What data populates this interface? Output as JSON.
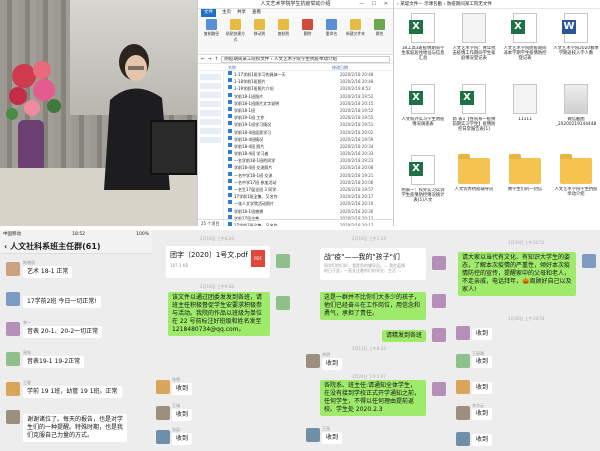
{
  "explorer": {
    "window_title": "人文艺术学院学生抗疫举动介绍",
    "ribbon_tabs": [
      "文件",
      "主页",
      "共享",
      "查看"
    ],
    "ribbon_buttons": [
      "复制路径",
      "粘贴快捷方式",
      "移动到",
      "复制到",
      "删除",
      "重命名",
      "新建文件夹",
      "新建项目",
      "轻松访问",
      "属性",
      "打开",
      "编辑",
      "历史记录",
      "全部选择",
      "全部取消",
      "反向选择"
    ],
    "address": "防疫期间某工院校文件 › 人文艺术学院学生抗疫举动介绍",
    "columns": [
      "名称",
      "修改日期"
    ],
    "files": [
      {
        "name": "1-17学前1班学习的具体一天",
        "date": "2020/2/18 20:48"
      },
      {
        "name": "1-18学前1班照片",
        "date": "2020/2/18 20:48"
      },
      {
        "name": "1-19学前1班照片介绍",
        "date": "2020/2/19 8:52"
      },
      {
        "name": "学前18-1班照片",
        "date": "2020/2/18 19:52"
      },
      {
        "name": "学前18-1班照片文字说明",
        "date": "2020/2/18 20:15"
      },
      {
        "name": "学前18-1班",
        "date": "2020/2/18 19:52"
      },
      {
        "name": "学前19-1班 工作",
        "date": "2020/2/18 19:55"
      },
      {
        "name": "学前19-1班学习情况",
        "date": "2020/2/18 19:51"
      },
      {
        "name": "学前18-4班居家学习",
        "date": "2020/2/18 20:02"
      },
      {
        "name": "学前18-4班情况",
        "date": "2020/2/18 19:59"
      },
      {
        "name": "学前18-4班 照片",
        "date": "2020/2/18 20:34"
      },
      {
        "name": "学前18-4班 学习者",
        "date": "2020/2/18 20:33"
      },
      {
        "name": "一名学前18-1班的同学",
        "date": "2020/2/18 19:23"
      },
      {
        "name": "学前18-4班 交流照片",
        "date": "2020/2/18 20:08"
      },
      {
        "name": "一名中学18-1班 交流",
        "date": "2020/2/18 19:21"
      },
      {
        "name": "一名中学17班 参加活动",
        "date": "2020/2/18 20:06"
      },
      {
        "name": "一名生17届全班 3 同学",
        "date": "2020/2/18 19:57"
      },
      {
        "name": "17学前1班全集、又名作",
        "date": "2020/2/18 20:17"
      },
      {
        "name": "一张人文学院活动照片",
        "date": "2020/2/18 20:10"
      },
      {
        "name": "学前18-1班感想",
        "date": "2020/2/18 20:30"
      },
      {
        "name": "学前17届全集",
        "date": "2020/2/18 20:12"
      },
      {
        "name": "17学前1班全集、又名作",
        "date": "2020/2/18 20:17"
      },
      {
        "name": "看看你做——人文艺术学院的生活介绍",
        "date": "2020/2/18 20:14"
      }
    ],
    "status": "25 个项目"
  },
  "iconview": {
    "address": "› 某堤文件— 示课包勤 › 防疫期间某工院无文件",
    "tiles": [
      {
        "kind": "xls",
        "label": "18工高3班疫情期间学生家庭居住地址与信息汇总"
      },
      {
        "kind": "blank",
        "label": "人文艺术学院：青年抗击疫情工作期间学生家庭情况登记表"
      },
      {
        "kind": "xls",
        "label": "人文艺术学院防疫期间非本学期学生疫情防控登记表"
      },
      {
        "kind": "wrd",
        "label": "人文艺术学院2020春季学期返校入学人数"
      },
      {
        "kind": "xls",
        "label": "人文校外实习学生防疫情况调查表"
      },
      {
        "kind": "xls",
        "label": "新 表1【各院系—疫情前期实习学生】疫情防控日常报告表[1]"
      },
      {
        "kind": "blank",
        "label": "11111"
      },
      {
        "kind": "img",
        "label": "微信截图_20200219144448"
      },
      {
        "kind": "xls",
        "label": "附表一：校外实习实训学生疫情防控情况统计表(1)人文"
      },
      {
        "kind": "folder",
        "label": "人文优秀抗疫辅导员"
      },
      {
        "kind": "folder",
        "label": "致学生们的一封信"
      },
      {
        "kind": "folder",
        "label": "人文艺术学院学生抗疫举动介绍"
      }
    ]
  },
  "chat": {
    "status_bar": {
      "carrier": "中国移动",
      "time": "18:52",
      "battery": "100%"
    },
    "group_title": "人文社科系班主任群(61)",
    "col1": [
      {
        "name": "陈晓丽",
        "text": "艺术 18-1 正常",
        "bubble": "white"
      },
      {
        "name": "",
        "text": "17学前2班 今日一切正常!",
        "bubble": "white"
      },
      {
        "name": "李一",
        "text": "音表 20-1、20-2一切正常",
        "bubble": "white"
      },
      {
        "name": "周铭",
        "text": "音表19-1 19-2正常",
        "bubble": "white"
      },
      {
        "name": "王健",
        "text": "学前 19 1班，幼管 19 1班。正常",
        "bubble": "white"
      },
      {
        "name": "",
        "text": "谢谢诸位了。每天的报告，也是对学生们的一种提醒。特殊时期，也是我们克服自己力量的方式。",
        "bubble": "white"
      }
    ],
    "col2": [
      {
        "time": "2月18日 上午8:26",
        "card_title": "团字〔2020〕1号文.pdf",
        "card_size": "187.1 KB",
        "card_badge": "PDF"
      },
      {
        "time": "2月18日 上午9:38",
        "text": "该文件以通过团委发发到各班，请班主任积极督促学生安要求积极参与活动。我院的作品以班级为单位在 22 号前标注好班级和姓名发至1218480734@qq.com。",
        "link": "1218480734@qq.com",
        "bubble": "green"
      },
      {
        "name": "张雪",
        "text": "收到",
        "bubble": "white"
      },
      {
        "name": "王瑞",
        "text": "收到",
        "bubble": "white"
      },
      {
        "name": "张梁",
        "text": "收到",
        "bubble": "white"
      }
    ],
    "col3": [
      {
        "time": "2月16日 上午1:24",
        "card_title": "战\"疫\"——我的\"孩子\"们",
        "card_sub": "同学们你们好，我是您的辅导员。... 我在疫情的日子里，一直关注着你们的学业、生活 ...",
        "card_footer": "人民艺术学院"
      },
      {
        "text": "这是一群并不比你们大多少的孩子，他们已经奋斗在工作岗位，用信念和勇气，承担了责任。",
        "bubble": "green"
      },
      {
        "text": "请精发到各班",
        "bubble": "green"
      },
      {
        "time": "2月13日 上午8:32",
        "name": "李明",
        "text": "收到",
        "bubble": "white"
      },
      {
        "time": "2月24日 下午1:07",
        "text": "各院系、班主任:请通知全体学生，在没有接到学校正式开学通知之前，任何学生，不得以任何理由提前返校。学生处 2020.2.3",
        "bubble": "green"
      },
      {
        "name": "王强",
        "text": "收到",
        "bubble": "white"
      }
    ],
    "col4": [
      {
        "time": "1月30日 上午10:52",
        "text": "请大家以当代有文化、有知识大学生的姿态，了解本次疫情的严重性，倾好本次疫情防控的宣传，提醒家中的父母和老人，不走亲戚，电话拜年，🎃周顾好自己以及家人!",
        "bubble": "green"
      },
      {
        "time": "1月30日 上午10:54",
        "name": "",
        "text": "收到",
        "bubble": "white"
      },
      {
        "name": "王丽雅",
        "text": "收到",
        "bubble": "white"
      },
      {
        "name": "",
        "text": "收到",
        "bubble": "white"
      },
      {
        "name": "李方云",
        "text": "收到",
        "bubble": "white"
      },
      {
        "name": "",
        "text": "收到",
        "bubble": "white"
      }
    ]
  },
  "colors": {
    "wechat_green": "#9eea6a",
    "chat_bg": "#ededed",
    "excel": "#1e7145",
    "word": "#2b579a",
    "pdf": "#e1463a",
    "folder": "#f4c350"
  }
}
